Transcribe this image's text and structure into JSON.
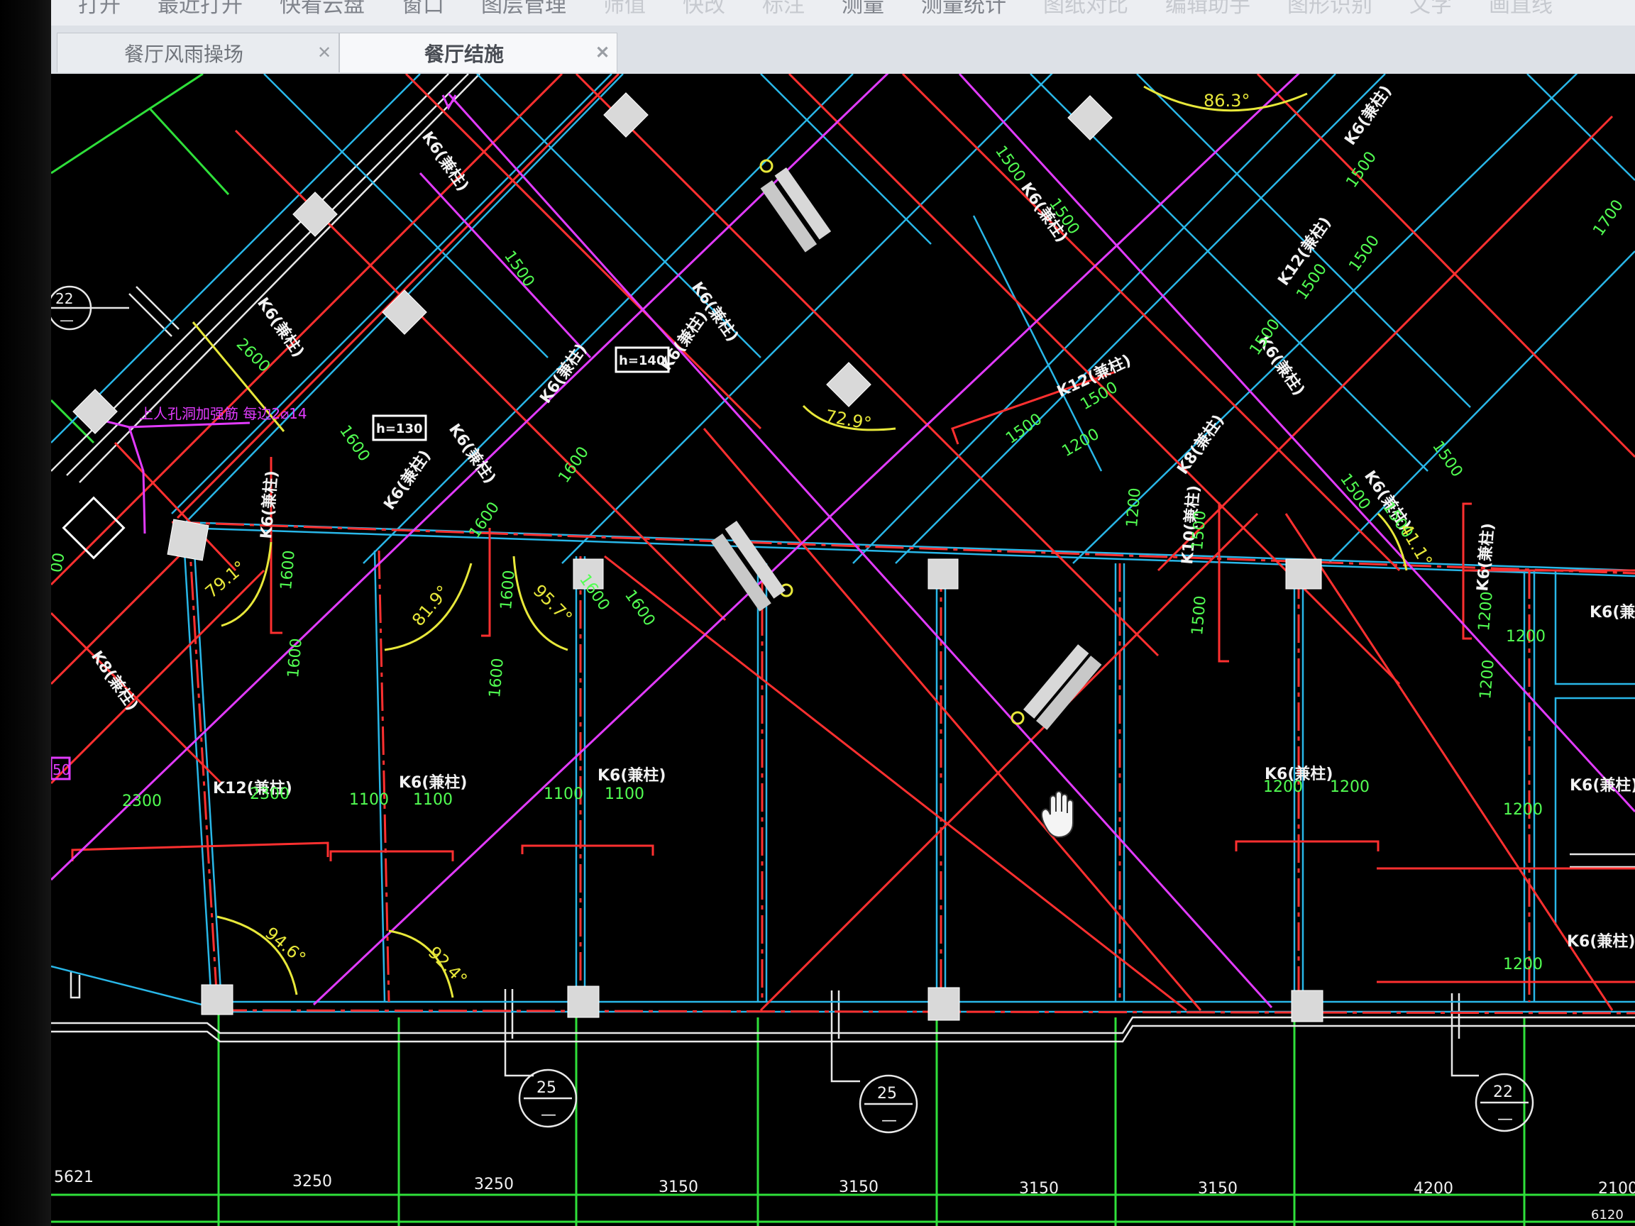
{
  "menu": {
    "items": [
      "打开",
      "最近打开",
      "快看云盘",
      "窗口",
      "图层管理",
      "筛值",
      "快改",
      "标注",
      "测量",
      "测量统计",
      "图纸对比",
      "编辑助手",
      "图形识别",
      "文字",
      "画直线"
    ]
  },
  "tabs": [
    {
      "label": "餐厅风雨操场",
      "active": false
    },
    {
      "label": "餐厅结施",
      "active": true
    }
  ],
  "drawing": {
    "colors": {
      "axis": "#2fe03a",
      "beam": "#ff3030",
      "wall": "#29b7e8",
      "slab": "#e23bff",
      "dim": "#52ff52",
      "angle": "#e8e83a",
      "text": "#ffffff"
    },
    "beam_labels": [
      "K6(兼柱)",
      "K6(兼柱)",
      "K6(兼柱)",
      "K6(兼柱)",
      "K6(兼柱)",
      "K6(兼柱)",
      "K6(兼柱)",
      "K12(兼柱)",
      "K12(兼柱)",
      "K10(兼柱)",
      "K8(兼柱)",
      "K8(兼柱)",
      "K6(兼柱)",
      "K6(兼柱)",
      "K6(兼柱)",
      "K6(兼柱)",
      "K6(兼柱)",
      "K6(兼柱)",
      "K12(兼柱)",
      "K6(兼柱)",
      "K6(兼柱)",
      "K6(兼柱)",
      "K6(兼柱)",
      "K6(兼柱)",
      "K6(兼柱)"
    ],
    "dims": [
      "1500",
      "1500",
      "1500",
      "1500",
      "1500",
      "1500",
      "1500",
      "1500",
      "1500",
      "1500",
      "1500",
      "1500",
      "1500",
      "1500",
      "1700",
      "2600",
      "1600",
      "1600",
      "1600",
      "1600",
      "1600",
      "1600",
      "1600",
      "1600",
      "1600",
      "1200",
      "1200",
      "1200",
      "1200",
      "1200",
      "1200",
      "1200",
      "2300",
      "2300",
      "1100",
      "1100",
      "1100",
      "1100",
      "1200",
      "1200"
    ],
    "angles": [
      "86.3°",
      "72.9°",
      "79.1°",
      "81.9°",
      "95.7°",
      "41.1°",
      "94.6°",
      "92.4°"
    ],
    "slab_thickness": [
      "h=140",
      "h=130"
    ],
    "pink_note": "上人孔洞加强筋 每边2⌀14",
    "section_marks": [
      {
        "num": "25",
        "sub": "—"
      },
      {
        "num": "25",
        "sub": "—"
      },
      {
        "num": "22",
        "sub": "—"
      },
      {
        "num": "22",
        "sub": "—"
      }
    ],
    "axis_dims": [
      "5621",
      "3250",
      "3250",
      "3150",
      "3150",
      "3150",
      "3150",
      "4200",
      "2100",
      "6120"
    ],
    "note_label": "50",
    "edge_label": "00"
  }
}
